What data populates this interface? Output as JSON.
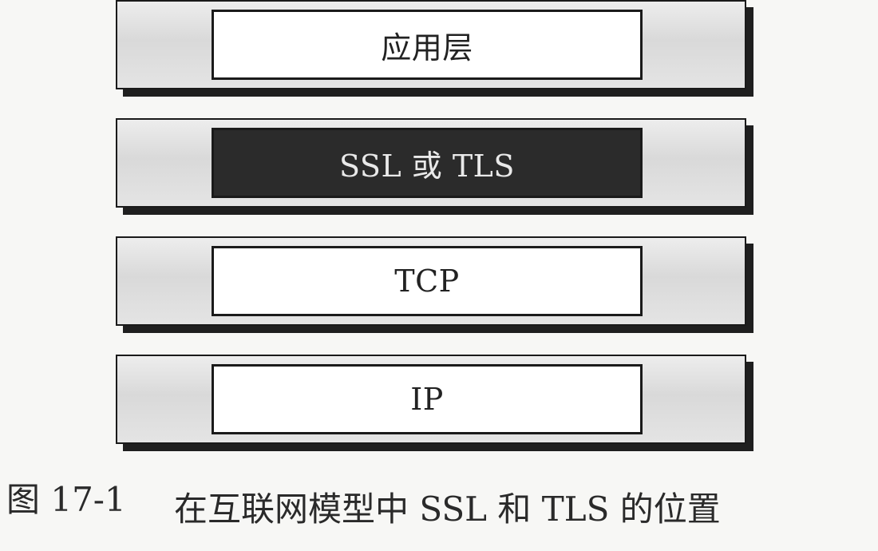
{
  "layers": [
    {
      "label": "应用层",
      "style": "light"
    },
    {
      "label": "SSL 或 TLS",
      "style": "dark"
    },
    {
      "label": "TCP",
      "style": "light"
    },
    {
      "label": "IP",
      "style": "light"
    }
  ],
  "caption": {
    "figure_number": "图 17-1",
    "text": "在互联网模型中 SSL 和 TLS 的位置"
  },
  "colors": {
    "dark_layer": "#2b2b2b",
    "light_layer": "#ffffff",
    "outer_frame": "#dcdcdc"
  }
}
